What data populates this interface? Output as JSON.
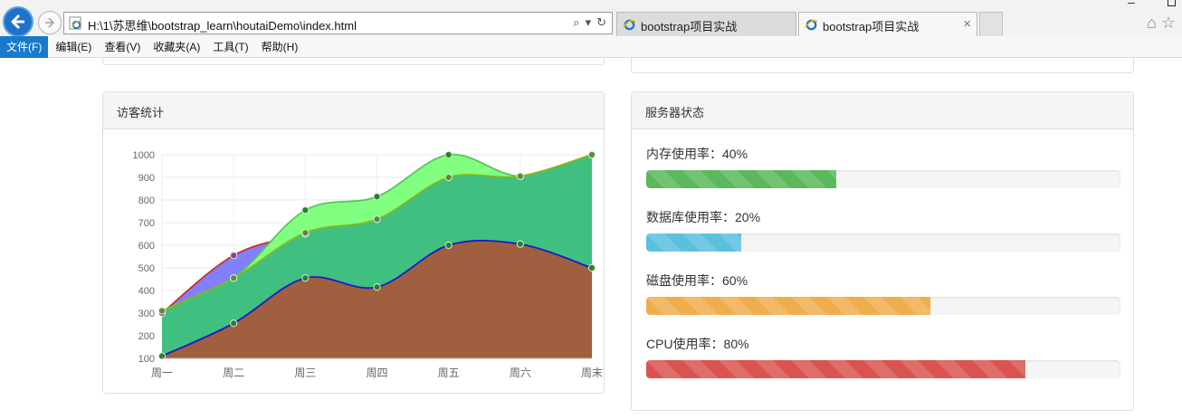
{
  "browser": {
    "address": "H:\\1\\苏思维\\bootstrap_learn\\houtaiDemo\\index.html",
    "tabs": [
      {
        "title": "bootstrap项目实战"
      },
      {
        "title": "bootstrap项目实战",
        "close": "×"
      }
    ],
    "menu": [
      "文件(F)",
      "编辑(E)",
      "查看(V)",
      "收藏夹(A)",
      "工具(T)",
      "帮助(H)"
    ]
  },
  "visitor_panel": {
    "title": "访客统计"
  },
  "server_panel": {
    "title": "服务器状态",
    "stats": [
      {
        "label": "内存使用率：40%",
        "value": 0.4,
        "color": "#5cb85c"
      },
      {
        "label": "数据库使用率：20%",
        "value": 0.2,
        "color": "#5bc0de"
      },
      {
        "label": "磁盘使用率：60%",
        "value": 0.6,
        "color": "#f0ad4e"
      },
      {
        "label": "CPU使用率：80%",
        "value": 0.8,
        "color": "#d9534f"
      }
    ]
  },
  "chart_data": {
    "type": "area",
    "title": "",
    "xlabel": "",
    "ylabel": "",
    "categories": [
      "周一",
      "周二",
      "周三",
      "周四",
      "周五",
      "周六",
      "周末"
    ],
    "ylim": [
      100,
      1000
    ],
    "yticks": [
      100,
      200,
      300,
      400,
      500,
      600,
      700,
      800,
      900,
      1000
    ],
    "grid": true,
    "series": [
      {
        "values": [
          300,
          555,
          650,
          715,
          900,
          905,
          1000
        ],
        "color": "#8080ff",
        "line": "#cc3322",
        "point": "#9933aa"
      },
      {
        "values": [
          310,
          455,
          755,
          815,
          1000,
          905,
          1000
        ],
        "color": "#80ff80",
        "line": "#5ac75a",
        "point": "#2e7d32"
      },
      {
        "values": [
          310,
          455,
          655,
          715,
          900,
          905,
          1000
        ],
        "color": "#40c080",
        "line": "#84b818",
        "point": "#5d8a3a"
      },
      {
        "values": [
          110,
          255,
          455,
          415,
          600,
          605,
          500
        ],
        "color": "#a0603f",
        "line": "#1a1acc",
        "point": "#2e7d32"
      }
    ]
  }
}
